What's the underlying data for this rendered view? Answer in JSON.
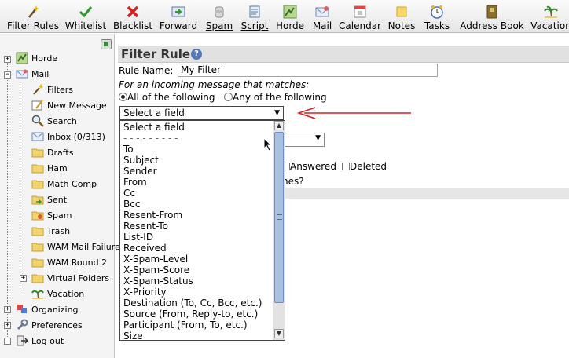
{
  "toolbar": {
    "items": [
      {
        "label": "Filter Rules",
        "icon": "wand-icon"
      },
      {
        "label": "Whitelist",
        "icon": "checkmark-icon"
      },
      {
        "label": "Blacklist",
        "icon": "x-icon"
      },
      {
        "label": "Forward",
        "icon": "forward-icon"
      },
      {
        "label": "Spam",
        "icon": "spam-icon"
      },
      {
        "label": "Script",
        "icon": "script-icon"
      },
      {
        "label": "Horde",
        "icon": "horde-icon"
      },
      {
        "label": "Mail",
        "icon": "mail-icon"
      },
      {
        "label": "Calendar",
        "icon": "calendar-icon"
      },
      {
        "label": "Notes",
        "icon": "notes-icon"
      },
      {
        "label": "Tasks",
        "icon": "clock-icon"
      },
      {
        "label": "Address Book",
        "icon": "address-book-icon"
      },
      {
        "label": "Vacation",
        "icon": "palm-tree-icon"
      }
    ]
  },
  "sidebar": {
    "items": [
      {
        "label": "Horde",
        "icon": "horde-icon"
      },
      {
        "label": "Mail",
        "icon": "mail-icon"
      },
      {
        "label": "Filters",
        "icon": "wand-icon"
      },
      {
        "label": "New Message",
        "icon": "compose-icon"
      },
      {
        "label": "Search",
        "icon": "magnifier-icon"
      },
      {
        "label": "Inbox (0/313)",
        "icon": "inbox-icon"
      },
      {
        "label": "Drafts",
        "icon": "folder-icon"
      },
      {
        "label": "Ham",
        "icon": "folder-icon"
      },
      {
        "label": "Math Comp",
        "icon": "folder-icon"
      },
      {
        "label": "Sent",
        "icon": "sent-folder-icon"
      },
      {
        "label": "Spam",
        "icon": "spam-folder-icon"
      },
      {
        "label": "Trash",
        "icon": "folder-icon"
      },
      {
        "label": "WAM Mail Failure",
        "icon": "folder-icon"
      },
      {
        "label": "WAM Round 2",
        "icon": "folder-icon"
      },
      {
        "label": "Virtual Folders",
        "icon": "folder-icon"
      },
      {
        "label": "Vacation",
        "icon": "palm-tree-icon"
      },
      {
        "label": "Organizing",
        "icon": "organizing-icon"
      },
      {
        "label": "Preferences",
        "icon": "wrench-icon"
      },
      {
        "label": "Log out",
        "icon": "logout-icon"
      }
    ]
  },
  "main": {
    "title": "Filter Rule",
    "rule_name_label": "Rule Name:",
    "rule_name_value": "My Filter",
    "match_prompt": "For an incoming message that matches:",
    "match_all_label": "All of the following",
    "match_any_label": "Any of the following",
    "field_select_value": "Select a field",
    "answered_label": "Answered",
    "deleted_label": "Deleted",
    "partial_question": "hes?",
    "field_options": [
      "Select a field",
      "- - - - - - - - -",
      "To",
      "Subject",
      "Sender",
      "From",
      "Cc",
      "Bcc",
      "Resent-From",
      "Resent-To",
      "List-ID",
      "Received",
      "X-Spam-Level",
      "X-Spam-Score",
      "X-Spam-Status",
      "X-Priority",
      "Destination (To, Cc, Bcc, etc.)",
      "Source (From, Reply-to, etc.)",
      "Participant (From, To, etc.)",
      "Size"
    ]
  },
  "colors": {
    "arrow": "#e41a1a",
    "scroll_thumb": "#a9c0e4"
  }
}
